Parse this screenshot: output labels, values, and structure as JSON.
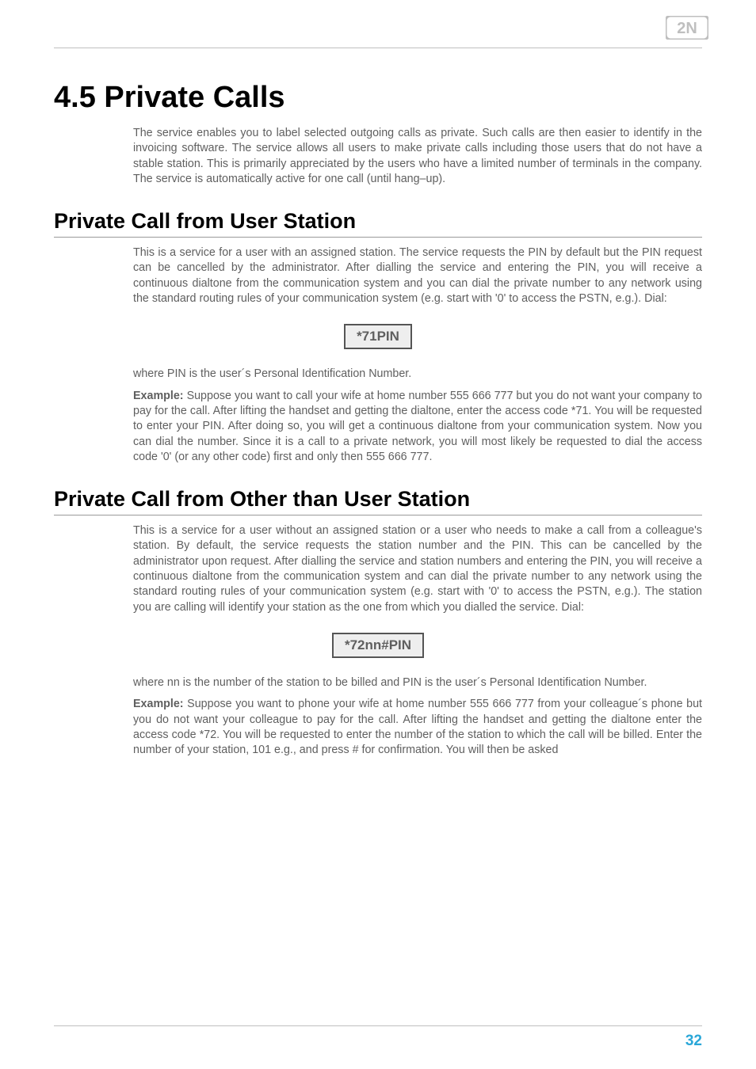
{
  "logo_text": "2N",
  "page_number": "32",
  "h1": "4.5 Private Calls",
  "intro": "The service enables you to label selected outgoing calls as private. Such calls are then easier to identify in the invoicing software. The service allows all users to make private calls including those users that do not have a stable station. This is primarily appreciated by the users who have a limited number of terminals in the company. The service is automatically active for one call (until hang–up).",
  "section1": {
    "heading": "Private Call from User Station",
    "p1": "This is a service for a user with an assigned station. The service requests the PIN by default but the PIN request can be cancelled by the administrator. After dialling the service and entering the PIN, you will receive a continuous dialtone from the communication system and you can dial the private number to any network using the standard routing rules of your communication system (e.g. start with '0' to access the PSTN, e.g.). Dial:",
    "code": "*71PIN",
    "p2": "where PIN is the user´s Personal Identification Number.",
    "example_label": "Example:",
    "example_text": " Suppose you want to call your wife at home number 555 666 777 but you do not want your company to pay for the call. After lifting the handset and getting the dialtone, enter the access code *71. You will be requested to enter your PIN. After doing so, you will get a continuous dialtone from your communication system. Now you can dial the number. Since it is a call to a private network, you will most likely be requested to dial the access code '0' (or any other code) first and only then 555 666 777."
  },
  "section2": {
    "heading": "Private Call from Other than User Station",
    "p1": "This is a service for a user without an assigned station or a user who needs to make a call from a colleague's station. By default, the service requests the station number and the PIN. This can be cancelled by the administrator upon request. After dialling the service and station numbers and entering the PIN, you will receive a continuous dialtone from the communication system and can dial the private number to any network using the standard routing rules of your communication system (e.g. start with '0' to access the PSTN, e.g.). The station you are calling will identify your station as the one from which you dialled the service. Dial:",
    "code": "*72nn#PIN",
    "p2": "where nn is the number of the station to be billed and PIN is the user´s Personal Identification Number.",
    "example_label": "Example:",
    "example_text": " Suppose you want to phone your wife at home number 555 666 777 from your colleague´s phone but you do not want your colleague to pay for the call. After lifting the handset and getting the dialtone enter the access code *72. You will be requested to enter the number of the station to which the call will be billed. Enter the number of your station, 101 e.g., and press # for confirmation. You will then be asked"
  }
}
